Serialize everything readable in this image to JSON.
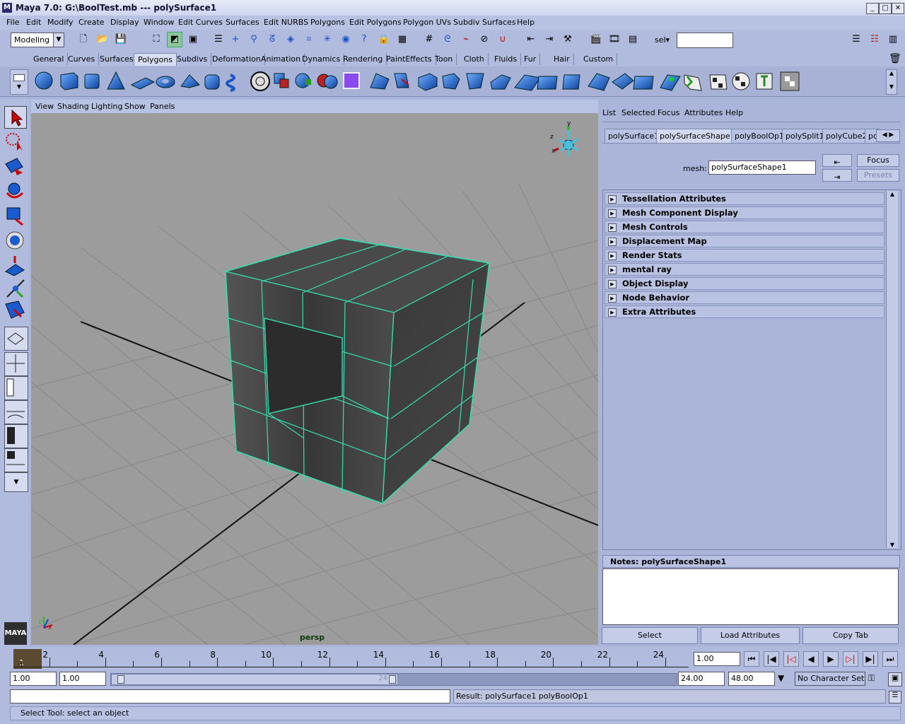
{
  "window": {
    "title": "Maya 7.0: G:\\BoolTest.mb  ---  polySurface1",
    "controls": [
      "_",
      "□",
      "✕"
    ]
  },
  "menubar": [
    "File",
    "Edit",
    "Modify",
    "Create",
    "Display",
    "Window",
    "Edit Curves",
    "Surfaces",
    "Edit NURBS",
    "Polygons",
    "Edit Polygons",
    "Polygon UVs",
    "Subdiv Surfaces",
    "Help"
  ],
  "status": {
    "menu_set": "Modeling",
    "sel_label": "sel▾",
    "sel_value": ""
  },
  "shelf_tabs": [
    "General",
    "Curves",
    "Surfaces",
    "Polygons",
    "Subdivs",
    "Deformation",
    "Animation",
    "Dynamics",
    "Rendering",
    "PaintEffects",
    "Toon",
    "Cloth",
    "Fluids",
    "Fur",
    "Hair",
    "Custom"
  ],
  "shelf_active": "Polygons",
  "viewport": {
    "menu": [
      "View",
      "Shading",
      "Lighting",
      "Show",
      "Panels"
    ],
    "camera_label": "persp",
    "axis": {
      "x": "x",
      "y": "y",
      "z": "z"
    },
    "colors": {
      "background": "#9c9c9c",
      "wire": "#33e0b0",
      "grid": "#7f7f7f"
    }
  },
  "attribute_editor": {
    "menu": [
      "List",
      "Selected",
      "Focus",
      "Attributes",
      "Help"
    ],
    "tabs": [
      "polySurface1",
      "polySurfaceShape1",
      "polyBoolOp1",
      "polySplit1",
      "polyCube2",
      "pc"
    ],
    "active_tab": "polySurfaceShape1",
    "mesh_label": "mesh:",
    "mesh_value": "polySurfaceShape1",
    "focus_button": "Focus",
    "presets_button": "Presets",
    "sections": [
      "Tessellation Attributes",
      "Mesh Component Display",
      "Mesh Controls",
      "Displacement Map",
      "Render Stats",
      "mental ray",
      "Object Display",
      "Node Behavior",
      "Extra Attributes"
    ],
    "notes_label": "Notes:  polySurfaceShape1",
    "notes_text": "",
    "buttons": [
      "Select",
      "Load Attributes",
      "Copy Tab"
    ]
  },
  "timeline": {
    "current_frame": "1",
    "labels": [
      "2",
      "4",
      "6",
      "8",
      "10",
      "12",
      "14",
      "16",
      "18",
      "20",
      "22",
      "24"
    ],
    "current_time_field": "1.00",
    "playback": [
      "⏮",
      "|◀",
      "|◁",
      "◀",
      "▶",
      "▷|",
      "▶|",
      "⏭"
    ]
  },
  "range": {
    "start": "1.00",
    "playback_start": "1.00",
    "slider_end_label": "24",
    "playback_end": "24.00",
    "end": "48.00",
    "character_set": "No Character Set"
  },
  "command_line": {
    "input": "",
    "result": "Result: polySurface1 polyBoolOp1"
  },
  "help_line": "Select Tool: select an object",
  "logo": "MAYA"
}
